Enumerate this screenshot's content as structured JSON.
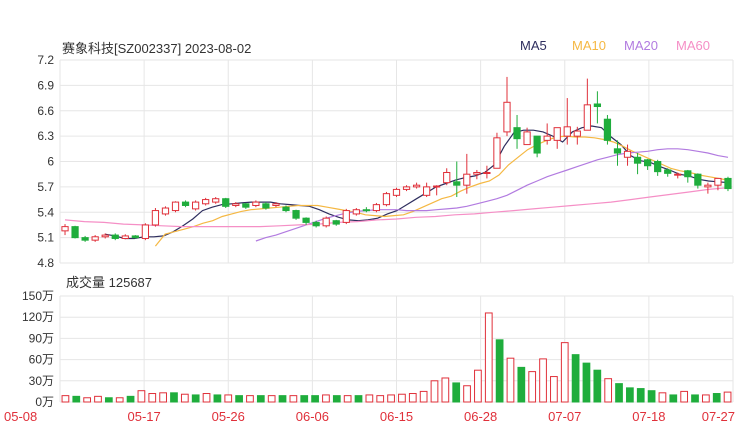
{
  "header": {
    "title": "赛象科技[SZ002337] 2023-08-02",
    "ma_labels": [
      "MA5",
      "MA10",
      "MA20",
      "MA60"
    ],
    "ma_colors": [
      "#2e2e5e",
      "#f5b843",
      "#b27be0",
      "#f58fc6"
    ]
  },
  "volume_header": {
    "label": "成交量",
    "value": "125687"
  },
  "colors": {
    "up": "#e0303a",
    "down": "#1fad3c",
    "grid": "#e6e6e6",
    "axis": "#333333",
    "date_label": "#e0303a"
  },
  "chart_data": [
    {
      "type": "candlestick",
      "title": "赛象科技[SZ002337] 2023-08-02",
      "ylim": [
        4.8,
        7.2
      ],
      "yticks": [
        "7.2",
        "6.9",
        "6.6",
        "6.3",
        "6",
        "5.7",
        "5.4",
        "5.1",
        "4.8"
      ],
      "xticks": [
        "05-08",
        "05-17",
        "05-26",
        "06-06",
        "06-15",
        "06-28",
        "07-07",
        "07-18",
        "07-27"
      ],
      "candles": [
        [
          5.18,
          5.23,
          5.13,
          5.26
        ],
        [
          5.23,
          5.1,
          5.09,
          5.24
        ],
        [
          5.1,
          5.07,
          5.05,
          5.12
        ],
        [
          5.07,
          5.11,
          5.05,
          5.13
        ],
        [
          5.11,
          5.13,
          5.09,
          5.15
        ],
        [
          5.13,
          5.09,
          5.07,
          5.15
        ],
        [
          5.09,
          5.12,
          5.08,
          5.14
        ],
        [
          5.12,
          5.1,
          5.09,
          5.13
        ],
        [
          5.09,
          5.25,
          5.07,
          5.27
        ],
        [
          5.25,
          5.42,
          5.23,
          5.45
        ],
        [
          5.38,
          5.45,
          5.36,
          5.47
        ],
        [
          5.42,
          5.52,
          5.4,
          5.53
        ],
        [
          5.52,
          5.48,
          5.46,
          5.54
        ],
        [
          5.44,
          5.52,
          5.42,
          5.54
        ],
        [
          5.5,
          5.55,
          5.48,
          5.57
        ],
        [
          5.52,
          5.56,
          5.5,
          5.58
        ],
        [
          5.56,
          5.47,
          5.45,
          5.57
        ],
        [
          5.48,
          5.5,
          5.46,
          5.52
        ],
        [
          5.5,
          5.46,
          5.44,
          5.51
        ],
        [
          5.48,
          5.52,
          5.46,
          5.54
        ],
        [
          5.5,
          5.45,
          5.43,
          5.52
        ],
        [
          5.48,
          5.5,
          5.46,
          5.52
        ],
        [
          5.46,
          5.42,
          5.4,
          5.48
        ],
        [
          5.42,
          5.33,
          5.31,
          5.43
        ],
        [
          5.33,
          5.28,
          5.25,
          5.34
        ],
        [
          5.28,
          5.24,
          5.22,
          5.3
        ],
        [
          5.24,
          5.33,
          5.22,
          5.35
        ],
        [
          5.3,
          5.26,
          5.24,
          5.31
        ],
        [
          5.28,
          5.42,
          5.26,
          5.44
        ],
        [
          5.38,
          5.43,
          5.36,
          5.45
        ],
        [
          5.43,
          5.42,
          5.4,
          5.46
        ],
        [
          5.42,
          5.49,
          5.4,
          5.51
        ],
        [
          5.49,
          5.62,
          5.47,
          5.64
        ],
        [
          5.6,
          5.67,
          5.58,
          5.69
        ],
        [
          5.67,
          5.7,
          5.65,
          5.72
        ],
        [
          5.7,
          5.72,
          5.68,
          5.75
        ],
        [
          5.6,
          5.7,
          5.58,
          5.75
        ],
        [
          5.7,
          5.71,
          5.6,
          5.72
        ],
        [
          5.75,
          5.87,
          5.72,
          5.92
        ],
        [
          5.76,
          5.72,
          5.58,
          6.0
        ],
        [
          5.72,
          5.85,
          5.62,
          6.09
        ],
        [
          5.85,
          5.87,
          5.79,
          5.9
        ],
        [
          5.87,
          5.87,
          5.8,
          5.95
        ],
        [
          5.92,
          6.28,
          5.92,
          6.34
        ],
        [
          6.35,
          6.7,
          6.3,
          7.0
        ],
        [
          6.4,
          6.27,
          6.15,
          6.55
        ],
        [
          6.2,
          6.35,
          6.2,
          6.4
        ],
        [
          6.3,
          6.1,
          6.05,
          6.3
        ],
        [
          6.25,
          6.3,
          6.2,
          6.45
        ],
        [
          6.25,
          6.4,
          6.15,
          6.4
        ],
        [
          6.3,
          6.41,
          6.2,
          6.75
        ],
        [
          6.3,
          6.36,
          6.2,
          6.41
        ],
        [
          6.37,
          6.67,
          6.37,
          6.98
        ],
        [
          6.68,
          6.65,
          6.45,
          6.83
        ],
        [
          6.5,
          6.25,
          6.2,
          6.55
        ],
        [
          6.15,
          6.1,
          5.95,
          6.25
        ],
        [
          6.05,
          6.12,
          5.95,
          6.2
        ],
        [
          6.05,
          5.98,
          5.85,
          6.1
        ],
        [
          6.02,
          5.95,
          5.9,
          6.03
        ],
        [
          6.0,
          5.88,
          5.83,
          6.02
        ],
        [
          5.9,
          5.86,
          5.82,
          5.92
        ],
        [
          5.84,
          5.85,
          5.8,
          5.87
        ],
        [
          5.89,
          5.82,
          5.75,
          5.9
        ],
        [
          5.85,
          5.72,
          5.68,
          5.86
        ],
        [
          5.7,
          5.72,
          5.62,
          5.75
        ],
        [
          5.72,
          5.8,
          5.66,
          5.8
        ],
        [
          5.8,
          5.68,
          5.65,
          5.82
        ]
      ],
      "ma": [
        {
          "name": "MA5",
          "start": 4,
          "values": [
            5.14,
            5.12,
            5.09,
            5.09,
            5.11,
            5.11,
            5.12,
            5.17,
            5.24,
            5.32,
            5.42,
            5.46,
            5.49,
            5.5,
            5.51,
            5.52,
            5.52,
            5.52,
            5.5,
            5.49,
            5.48,
            5.47,
            5.43,
            5.38,
            5.34,
            5.31,
            5.3,
            5.31,
            5.33,
            5.38,
            5.42,
            5.49,
            5.56,
            5.63,
            5.7,
            5.74,
            5.78,
            5.81,
            5.83,
            5.87,
            5.96,
            6.18,
            6.34,
            6.37,
            6.37,
            6.35,
            6.3,
            6.23,
            6.35,
            6.4,
            6.42,
            6.4,
            6.29,
            6.2,
            6.07,
            6.01,
            5.99,
            5.94,
            5.9,
            5.85,
            5.83,
            5.79,
            5.77,
            5.76,
            5.75
          ]
        },
        {
          "name": "MA10",
          "start": 9,
          "values": [
            5.0,
            5.14,
            5.17,
            5.2,
            5.23,
            5.27,
            5.3,
            5.35,
            5.38,
            5.41,
            5.43,
            5.44,
            5.45,
            5.46,
            5.47,
            5.48,
            5.48,
            5.48,
            5.46,
            5.44,
            5.42,
            5.4,
            5.37,
            5.36,
            5.35,
            5.36,
            5.37,
            5.41,
            5.46,
            5.51,
            5.56,
            5.59,
            5.65,
            5.7,
            5.74,
            5.77,
            5.84,
            5.96,
            6.05,
            6.14,
            6.2,
            6.25,
            6.29,
            6.3,
            6.29,
            6.29,
            6.28,
            6.26,
            6.23,
            6.18,
            6.12,
            6.07,
            6.02,
            5.97,
            5.92,
            5.89,
            5.87,
            5.84,
            5.82,
            5.8,
            5.78
          ]
        },
        {
          "name": "MA20",
          "start": 19,
          "values": [
            5.06,
            5.1,
            5.13,
            5.17,
            5.21,
            5.25,
            5.29,
            5.33,
            5.36,
            5.39,
            5.41,
            5.42,
            5.43,
            5.43,
            5.43,
            5.42,
            5.42,
            5.42,
            5.43,
            5.44,
            5.45,
            5.47,
            5.5,
            5.53,
            5.56,
            5.6,
            5.66,
            5.72,
            5.77,
            5.82,
            5.86,
            5.9,
            5.94,
            5.98,
            6.02,
            6.05,
            6.08,
            6.1,
            6.11,
            6.12,
            6.14,
            6.15,
            6.15,
            6.14,
            6.12,
            6.1,
            6.07,
            6.05
          ]
        },
        {
          "name": "MA60",
          "start": 0,
          "values": [
            5.31,
            5.29,
            5.28,
            5.26,
            5.25,
            5.24,
            5.23,
            5.23,
            5.23,
            5.23,
            5.23,
            5.24,
            5.25,
            5.26,
            5.28,
            5.29,
            5.31,
            5.32,
            5.34,
            5.35,
            5.37,
            5.38,
            5.4,
            5.42,
            5.44,
            5.46,
            5.48,
            5.5,
            5.52,
            5.55,
            5.58,
            5.61,
            5.64,
            5.67,
            5.69
          ]
        }
      ]
    },
    {
      "type": "bar",
      "title": "成交量 125687",
      "ylim": [
        0,
        150
      ],
      "yticks": [
        "150万",
        "120万",
        "90万",
        "60万",
        "30万",
        "0万"
      ],
      "values": [
        9,
        8,
        6,
        8,
        6,
        6,
        8,
        16,
        12,
        13,
        13,
        11,
        10,
        12,
        10,
        10,
        9,
        9,
        9,
        9,
        9,
        9,
        9,
        9,
        10,
        9,
        9,
        9,
        10,
        9,
        10,
        11,
        12,
        15,
        30,
        34,
        27,
        23,
        45,
        126,
        88,
        62,
        49,
        43,
        61,
        36,
        84,
        67,
        55,
        45,
        33,
        26,
        20,
        19,
        16,
        13,
        10,
        15,
        10,
        10,
        12,
        14
      ],
      "up": [
        1,
        0,
        1,
        1,
        0,
        1,
        0,
        1,
        1,
        1,
        0,
        1,
        0,
        1,
        0,
        1,
        0,
        1,
        0,
        1,
        0,
        1,
        0,
        0,
        1,
        0,
        1,
        0,
        1,
        1,
        1,
        1,
        1,
        1,
        1,
        1,
        0,
        1,
        1,
        1,
        0,
        1,
        0,
        1,
        1,
        1,
        1,
        0,
        0,
        0,
        1,
        0,
        0,
        0,
        0,
        1,
        0,
        1,
        0,
        1,
        0,
        1
      ]
    }
  ]
}
